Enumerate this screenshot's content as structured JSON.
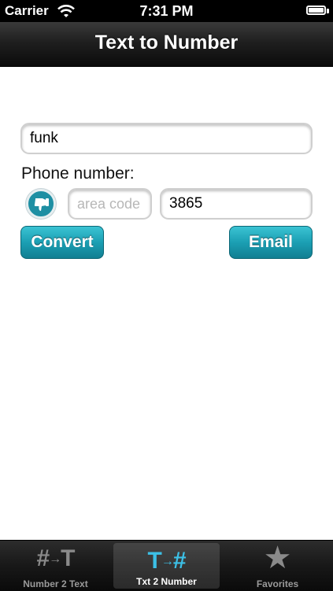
{
  "status_bar": {
    "carrier": "Carrier",
    "time": "7:31 PM"
  },
  "nav": {
    "title": "Text to Number"
  },
  "form": {
    "text_value": "funk",
    "phone_label": "Phone number:",
    "area_code_value": "",
    "area_code_placeholder": "area code",
    "number_value": "3865",
    "thumb_icon": "thumbs-down-icon"
  },
  "actions": {
    "convert_label": "Convert",
    "email_label": "Email"
  },
  "tabs": [
    {
      "label": "Number 2 Text",
      "icon": "#→T",
      "active": false
    },
    {
      "label": "Txt 2 Number",
      "icon": "T→#",
      "active": true
    },
    {
      "label": "Favorites",
      "icon": "star-icon",
      "active": false
    }
  ],
  "colors": {
    "accent": "#1b9fb3",
    "active_tab_icon": "#3cc0e6"
  }
}
